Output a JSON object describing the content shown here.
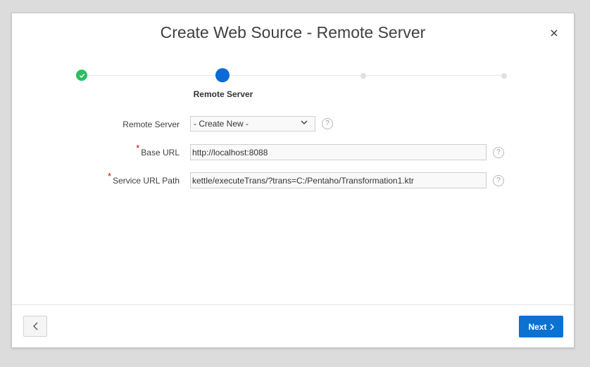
{
  "dialog": {
    "title": "Create Web Source - Remote Server",
    "close_icon": "close-icon"
  },
  "wizard": {
    "current_step_label": "Remote Server",
    "steps_total": 4,
    "current_step": 2
  },
  "form": {
    "remote_server": {
      "label": "Remote Server",
      "selected": "- Create New -"
    },
    "base_url": {
      "label": "Base URL",
      "value": "http://localhost:8088",
      "required": "*"
    },
    "service_url_path": {
      "label": "Service URL Path",
      "value": "kettle/executeTrans/?trans=C:/Pentaho/Transformation1.ktr",
      "required": "*"
    },
    "help_glyph": "?"
  },
  "footer": {
    "next_label": "Next"
  },
  "colors": {
    "accent": "#0b72d2",
    "success": "#2bbf63",
    "required": "#d00000"
  }
}
